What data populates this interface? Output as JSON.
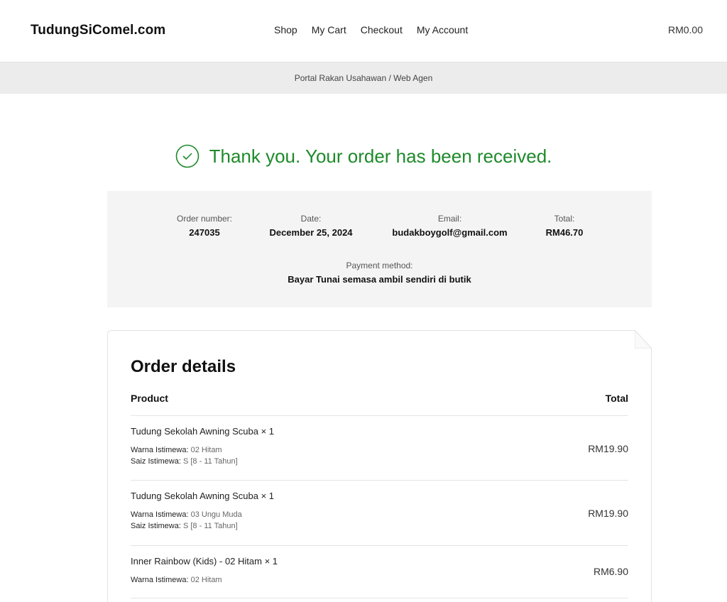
{
  "header": {
    "logo": "TudungSiComel.com",
    "nav": [
      "Shop",
      "My Cart",
      "Checkout",
      "My Account"
    ],
    "cart_total": "RM0.00"
  },
  "subbar": {
    "link": "Portal Rakan Usahawan / Web Agen"
  },
  "confirmation": {
    "message": "Thank you. Your order has been received.",
    "icon": "check-circle-icon",
    "color": "#1e8a2b"
  },
  "overview": {
    "order_number_label": "Order number:",
    "order_number": "247035",
    "date_label": "Date:",
    "date": "December 25, 2024",
    "email_label": "Email:",
    "email": "budakboygolf@gmail.com",
    "total_label": "Total:",
    "total": "RM46.70",
    "payment_label": "Payment method:",
    "payment": "Bayar Tunai semasa ambil sendiri di butik"
  },
  "order_details": {
    "title": "Order details",
    "col_product": "Product",
    "col_total": "Total",
    "items": [
      {
        "name": "Tudung Sekolah Awning Scuba × 1",
        "meta": [
          {
            "label": "Warna Istimewa:",
            "value": "02 Hitam"
          },
          {
            "label": "Saiz Istimewa:",
            "value": "S [8 - 11 Tahun]"
          }
        ],
        "price": "RM19.90"
      },
      {
        "name": "Tudung Sekolah Awning Scuba × 1",
        "meta": [
          {
            "label": "Warna Istimewa:",
            "value": "03 Ungu Muda"
          },
          {
            "label": "Saiz Istimewa:",
            "value": "S [8 - 11 Tahun]"
          }
        ],
        "price": "RM19.90"
      },
      {
        "name": "Inner Rainbow (Kids) - 02 Hitam × 1",
        "meta": [
          {
            "label": "Warna Istimewa:",
            "value": "02 Hitam"
          }
        ],
        "price": "RM6.90"
      }
    ]
  }
}
